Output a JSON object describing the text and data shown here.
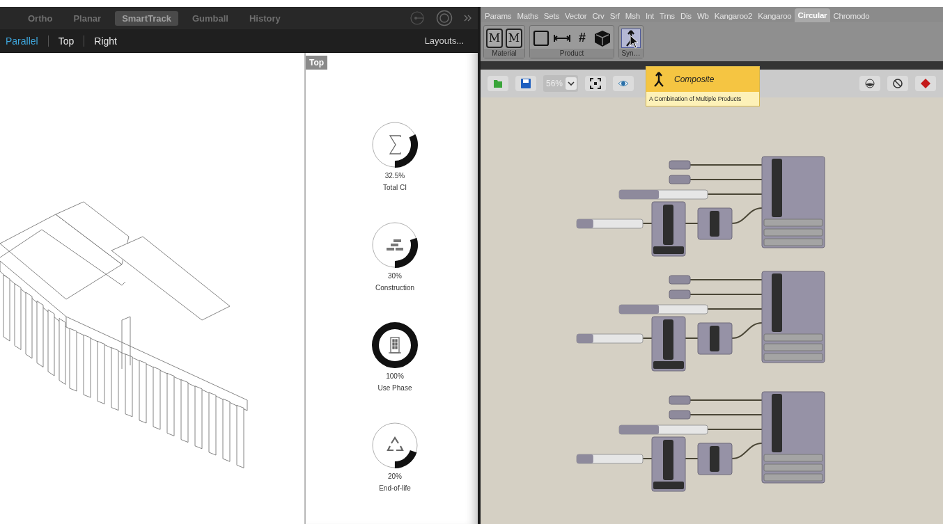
{
  "viewport_toolbar": {
    "toggles": [
      {
        "label": "Ortho",
        "on": false
      },
      {
        "label": "Planar",
        "on": false
      },
      {
        "label": "SmartTrack",
        "on": true
      },
      {
        "label": "Gumball",
        "on": false
      },
      {
        "label": "History",
        "on": false
      }
    ]
  },
  "view_tabs": {
    "tabs": [
      {
        "label": "Parallel",
        "selected": true
      },
      {
        "label": "Top",
        "selected": false
      },
      {
        "label": "Right",
        "selected": false
      }
    ],
    "layouts": "Layouts..."
  },
  "top_view": {
    "label": "Top",
    "gauges": [
      {
        "level": 0.325,
        "value": "32.5%",
        "name": "Total CI"
      },
      {
        "level": 0.3,
        "value": "30%",
        "name": "Construction"
      },
      {
        "level": 1,
        "value": "100%",
        "name": "Use Phase"
      },
      {
        "level": 0.2,
        "value": "20%",
        "name": "End-of-life"
      }
    ]
  },
  "grasshopper": {
    "tabs": [
      {
        "label": "Params",
        "selected": false
      },
      {
        "label": "Maths",
        "selected": false
      },
      {
        "label": "Sets",
        "selected": false
      },
      {
        "label": "Vector",
        "selected": false
      },
      {
        "label": "Crv",
        "selected": false
      },
      {
        "label": "Srf",
        "selected": false
      },
      {
        "label": "Msh",
        "selected": false
      },
      {
        "label": "Int",
        "selected": false
      },
      {
        "label": "Trns",
        "selected": false
      },
      {
        "label": "Dis",
        "selected": false
      },
      {
        "label": "Wb",
        "selected": false
      },
      {
        "label": "Kangaroo2",
        "selected": false
      },
      {
        "label": "Kangaroo",
        "selected": false
      },
      {
        "label": "Circular",
        "selected": true
      },
      {
        "label": "Chromodo",
        "selected": false
      }
    ],
    "ribbon_groups": [
      {
        "label": "Material",
        "buttons": [
          {
            "kind": "letter",
            "text": "M",
            "selected": false
          },
          {
            "kind": "letter",
            "text": "M",
            "selected": false
          }
        ]
      },
      {
        "label": "Product",
        "buttons": [
          {
            "kind": "square",
            "selected": false
          },
          {
            "kind": "dimension",
            "selected": false
          },
          {
            "kind": "letter",
            "text": "#",
            "selected": false
          },
          {
            "kind": "cube",
            "selected": false
          }
        ]
      },
      {
        "label": "Syn…",
        "buttons": [
          {
            "kind": "merge",
            "selected": true
          }
        ]
      }
    ],
    "zoom": "56%",
    "tooltip": {
      "title": "Composite",
      "description": "A Combination of Multiple Products"
    },
    "canvas": {
      "clusters": [
        {
          "long_slider": {
            "level": 0.45
          },
          "short_slider": {
            "level": 0.25
          }
        },
        {
          "long_slider": {
            "level": 0.45
          },
          "short_slider": {
            "level": 0.25
          }
        },
        {
          "long_slider": {
            "level": 0.45
          },
          "short_slider": {
            "level": 0.25
          }
        }
      ]
    }
  }
}
